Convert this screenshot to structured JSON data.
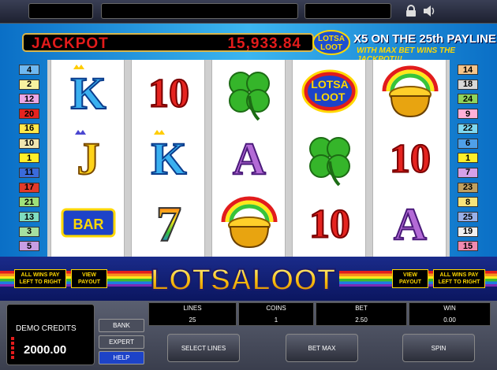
{
  "jackpot": {
    "label": "JACKPOT",
    "value": "15,933.84"
  },
  "promo": {
    "line1": "X5 ON THE 25th PAYLINE",
    "line2": "WITH MAX BET WINS THE JACKPOT!!!"
  },
  "logo": {
    "small_line1": "LOTSA",
    "small_line2": "LOOT",
    "main": "LOTSALOOT"
  },
  "paylines": {
    "left": [
      {
        "n": "4",
        "color": "#6fb8f0"
      },
      {
        "n": "2",
        "color": "#f7f2a0"
      },
      {
        "n": "12",
        "color": "#e9a7e6"
      },
      {
        "n": "20",
        "color": "#e52420"
      },
      {
        "n": "16",
        "color": "#ffe84a"
      },
      {
        "n": "10",
        "color": "#f0e6b0"
      },
      {
        "n": "1",
        "color": "#ffee2a"
      },
      {
        "n": "11",
        "color": "#3a6bdc"
      },
      {
        "n": "17",
        "color": "#e23a2a"
      },
      {
        "n": "21",
        "color": "#9ee07a"
      },
      {
        "n": "13",
        "color": "#7fdcc0"
      },
      {
        "n": "3",
        "color": "#a6e0a0"
      },
      {
        "n": "5",
        "color": "#c79ee4"
      }
    ],
    "right": [
      {
        "n": "14",
        "color": "#f5c48a"
      },
      {
        "n": "18",
        "color": "#d8d8d8"
      },
      {
        "n": "24",
        "color": "#8fd45c"
      },
      {
        "n": "9",
        "color": "#ffb0d8"
      },
      {
        "n": "22",
        "color": "#7ed8f0"
      },
      {
        "n": "6",
        "color": "#4fa0e8"
      },
      {
        "n": "1",
        "color": "#ffee2a"
      },
      {
        "n": "7",
        "color": "#d6a0e8"
      },
      {
        "n": "23",
        "color": "#c0a060"
      },
      {
        "n": "8",
        "color": "#f7e37a"
      },
      {
        "n": "25",
        "color": "#9ab0e8"
      },
      {
        "n": "19",
        "color": "#f0f0f0"
      },
      {
        "n": "15",
        "color": "#f08ab0"
      }
    ]
  },
  "reels": [
    [
      "K",
      "J",
      "BAR"
    ],
    [
      "10",
      "K",
      "7"
    ],
    [
      "clover",
      "A",
      "pot"
    ],
    [
      "lotsaloot",
      "clover",
      "10"
    ],
    [
      "pot",
      "10",
      "A"
    ]
  ],
  "symbols": {
    "bar_text": "BAR",
    "logo_line1": "LOTSA",
    "logo_line2": "LOOT"
  },
  "banner": {
    "all_wins_left": "ALL WINS PAY LEFT TO RIGHT",
    "view_payout_left": "VIEW PAYOUT",
    "view_payout_right": "VIEW PAYOUT",
    "all_wins_right": "ALL WINS PAY LEFT TO RIGHT"
  },
  "credits": {
    "label": "DEMO CREDITS",
    "value": "2000.00"
  },
  "side_buttons": {
    "bank": "BANK",
    "expert": "EXPERT",
    "help": "HELP"
  },
  "stats": {
    "lines_label": "LINES",
    "lines_value": "25",
    "coins_label": "COINS",
    "coins_value": "1",
    "bet_label": "BET",
    "bet_value": "2.50",
    "win_label": "WIN",
    "win_value": "0.00"
  },
  "buttons": {
    "select_lines": "SELECT LINES",
    "bet_max": "BET MAX",
    "spin": "SPIN"
  },
  "colors": {
    "jackpot_red": "#e31b1b",
    "gold": "#ffd800",
    "frame_blue": "#1a8de0"
  }
}
